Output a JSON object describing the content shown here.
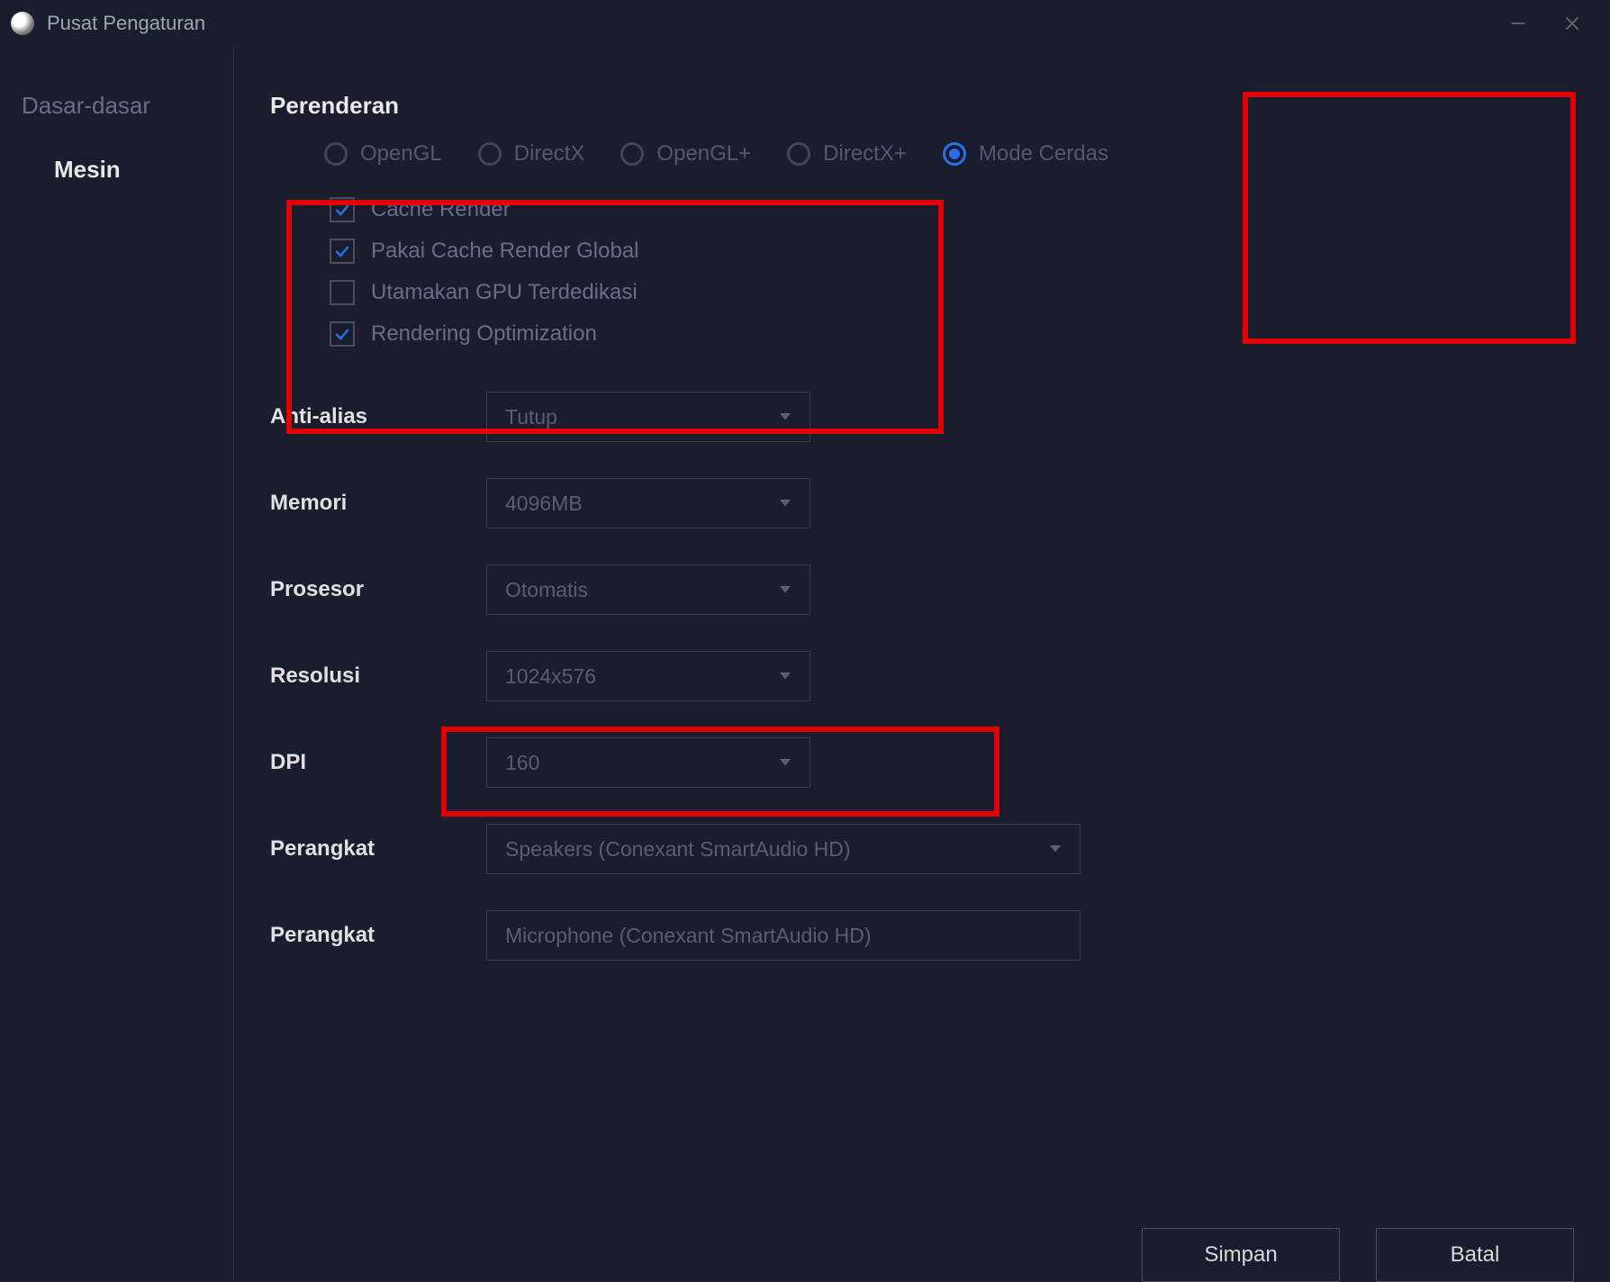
{
  "titlebar": {
    "title": "Pusat Pengaturan"
  },
  "sidebar": {
    "items": [
      {
        "label": "Dasar-dasar",
        "active": false
      },
      {
        "label": "Mesin",
        "active": true
      }
    ]
  },
  "render": {
    "section_title": "Perenderan",
    "modes": [
      {
        "label": "OpenGL",
        "selected": false
      },
      {
        "label": "DirectX",
        "selected": false
      },
      {
        "label": "OpenGL+",
        "selected": false
      },
      {
        "label": "DirectX+",
        "selected": false
      },
      {
        "label": "Mode Cerdas",
        "selected": true
      }
    ],
    "checkboxes": [
      {
        "label": "Cache Render",
        "checked": true
      },
      {
        "label": "Pakai Cache Render Global",
        "checked": true
      },
      {
        "label": "Utamakan GPU Terdedikasi",
        "checked": false
      },
      {
        "label": "Rendering Optimization",
        "checked": true
      }
    ]
  },
  "fields": {
    "anti_alias": {
      "label": "Anti-alias",
      "value": "Tutup"
    },
    "memory": {
      "label": "Memori",
      "value": "4096MB"
    },
    "processor": {
      "label": "Prosesor",
      "value": "Otomatis"
    },
    "resolution": {
      "label": "Resolusi",
      "value": "1024x576"
    },
    "dpi": {
      "label": "DPI",
      "value": "160"
    },
    "device_out": {
      "label": "Perangkat",
      "value": "Speakers (Conexant SmartAudio HD)"
    },
    "device_in": {
      "label": "Perangkat",
      "value": "Microphone (Conexant SmartAudio HD)"
    }
  },
  "footer": {
    "save": "Simpan",
    "cancel": "Batal"
  }
}
